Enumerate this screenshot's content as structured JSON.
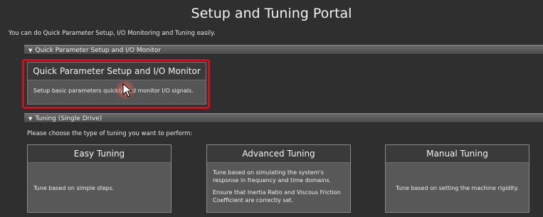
{
  "portal": {
    "title": "Setup and Tuning Portal",
    "intro": "You can do Quick Parameter Setup, I/O Monitoring and Tuning easily."
  },
  "sections": {
    "qps": {
      "expand_icon": "triangle-down-icon",
      "label": "Quick Parameter Setup and I/O Monitor"
    },
    "tuning": {
      "expand_icon": "triangle-down-icon",
      "label": "Tuning (Single Drive)"
    }
  },
  "qps_card": {
    "title": "Quick Parameter Setup and I/O Monitor",
    "description": "Setup basic parameters quickly and monitor I/O signals.",
    "highlight_color": "#d0101c"
  },
  "tuning_prompt": "Please choose the type of tuning you want to perform:",
  "tuning_cards": {
    "easy": {
      "title": "Easy Tuning",
      "description": "Tune based on simple steps."
    },
    "advanced": {
      "title": "Advanced Tuning",
      "description": "Tune based on simulating the system's response in frequency and time domains.",
      "note": "Ensure that Inertia Ratio and Viscous Friction Coefficient are correctly set."
    },
    "manual": {
      "title": "Manual Tuning",
      "description": "Tune based on setting the machine rigidity."
    }
  },
  "colors": {
    "background": "#2f2f2f",
    "card_header": "#3a3a3a",
    "card_body": "#585858",
    "highlight": "#d0101c"
  }
}
